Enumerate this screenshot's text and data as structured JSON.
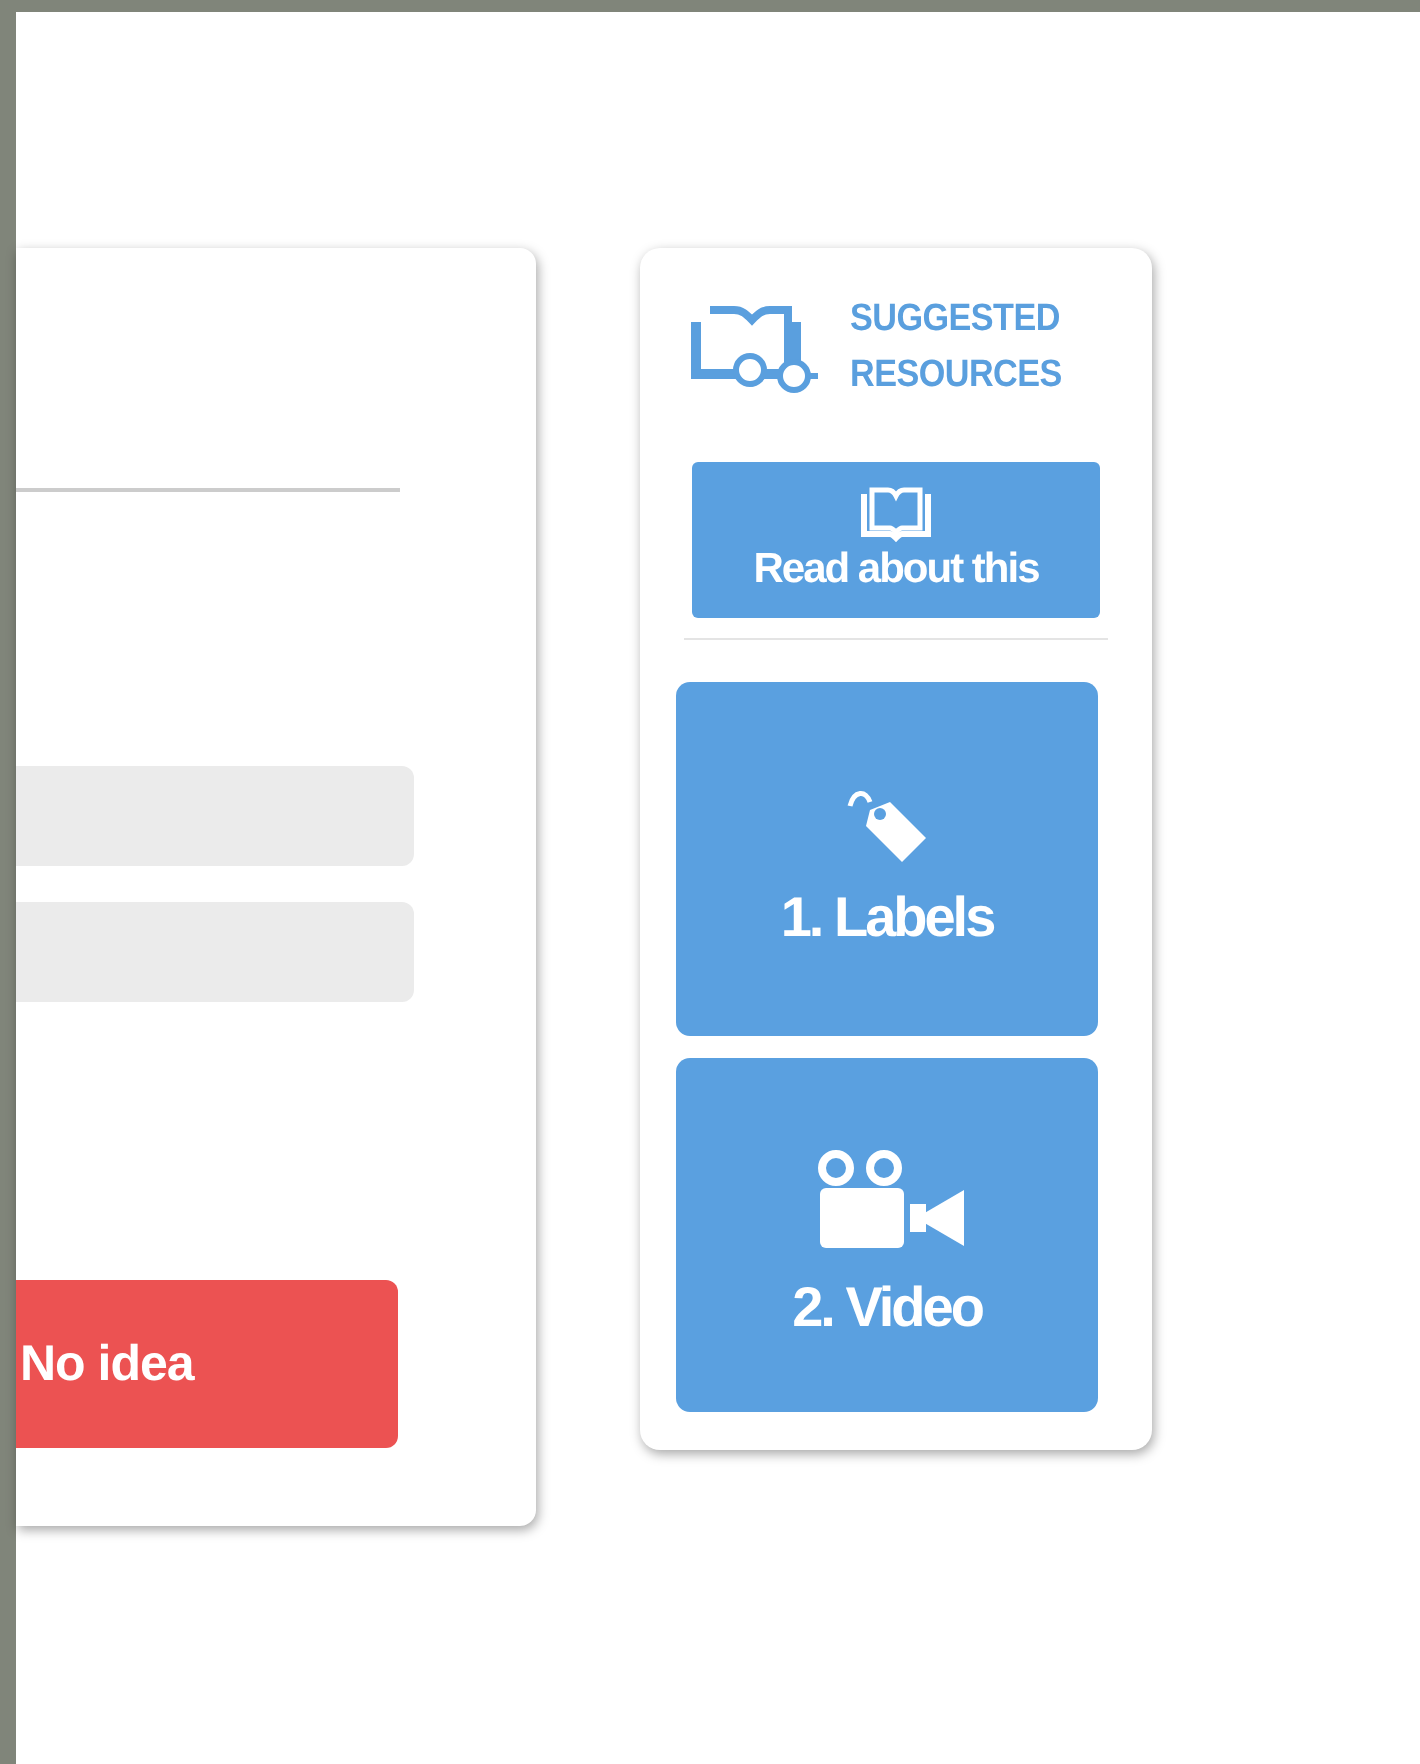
{
  "question_card": {
    "button": "No idea"
  },
  "resources": {
    "title": "SUGGESTED RESOURCES",
    "read_button": "Read about this",
    "items": [
      {
        "kind": "tag",
        "label": "1. Labels"
      },
      {
        "kind": "video",
        "label": "2. Video"
      }
    ]
  }
}
